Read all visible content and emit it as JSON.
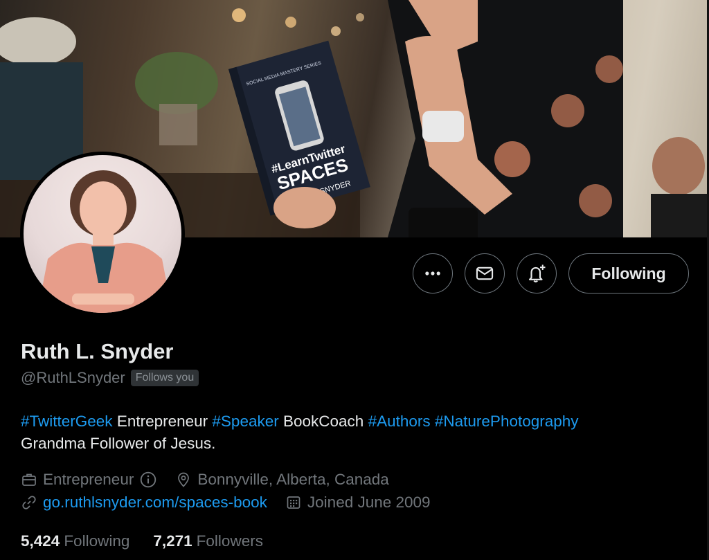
{
  "profile": {
    "name": "Ruth L. Snyder",
    "handle": "@RuthLSnyder",
    "follows_you": "Follows you",
    "bio": {
      "line1": [
        {
          "text": "#TwitterGeek",
          "hashtag": true
        },
        {
          "text": " Entrepreneur ",
          "hashtag": false
        },
        {
          "text": "#Speaker",
          "hashtag": true
        },
        {
          "text": " BookCoach ",
          "hashtag": false
        },
        {
          "text": "#Authors",
          "hashtag": true
        },
        {
          "text": " ",
          "hashtag": false
        },
        {
          "text": "#NaturePhotography",
          "hashtag": true
        }
      ],
      "line2": "Grandma Follower of Jesus."
    },
    "category": "Entrepreneur",
    "location": "Bonnyville, Alberta, Canada",
    "website": "go.ruthlsnyder.com/spaces-book",
    "joined": "Joined June 2009",
    "following_count": "5,424",
    "following_label": "Following",
    "followers_count": "7,271",
    "followers_label": "Followers"
  },
  "banner": {
    "book_series": "SOCIAL MEDIA MASTERY SERIES",
    "book_title_1": "#LearnTwitter",
    "book_title_2": "SPACES",
    "book_author": "L. SNYDER"
  },
  "actions": {
    "more_icon": "more-dots-icon",
    "message_icon": "envelope-icon",
    "notify_icon": "bell-plus-icon",
    "following_label": "Following"
  },
  "colors": {
    "accent": "#1d9bf0",
    "background": "#000000",
    "muted": "#71767b"
  }
}
